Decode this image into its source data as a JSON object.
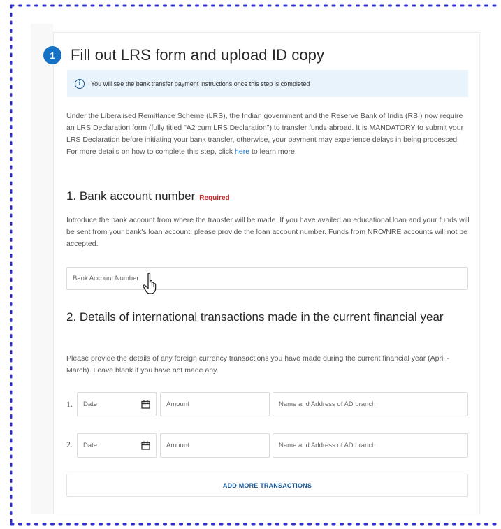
{
  "step": {
    "number": "1",
    "title": "Fill out LRS form and upload ID copy"
  },
  "info": {
    "icon": "info-icon",
    "text": "You will see the bank transfer payment instructions once this step is completed"
  },
  "intro": {
    "text_before_link": "Under the Liberalised Remittance Scheme (LRS), the Indian government and the Reserve Bank of India (RBI) now require an LRS Declaration form (fully titled \"A2 cum LRS Declaration\") to transfer funds abroad. It is MANDATORY to submit your LRS Declaration before initiating your bank transfer, otherwise, your payment may experience delays in being processed. For more details on how to complete this step, click ",
    "link_text": "here",
    "text_after_link": " to learn more."
  },
  "bank_section": {
    "title": "1. Bank account number",
    "required_label": "Required",
    "description": "Introduce the bank account from where the transfer will be made. If you have availed an educational loan and your funds will be sent from your bank's loan account, please provide the loan account number. Funds from NRO/NRE accounts will not be accepted.",
    "input_placeholder": "Bank Account Number"
  },
  "transactions_section": {
    "title": "2. Details of international transactions made in the current financial year",
    "description": "Please provide the details of any foreign currency transactions you have made during the current financial year (April - March). Leave blank if you have not made any.",
    "rows": [
      {
        "number": "1.",
        "date_placeholder": "Date",
        "amount_placeholder": "Amount",
        "branch_placeholder": "Name and Address of AD branch"
      },
      {
        "number": "2.",
        "date_placeholder": "Date",
        "amount_placeholder": "Amount",
        "branch_placeholder": "Name and Address of AD branch"
      }
    ],
    "add_button_label": "ADD MORE TRANSACTIONS"
  },
  "colors": {
    "accent": "#1670c4",
    "info_background": "#e8f3fc",
    "required": "#c62828",
    "frame_dots": "#2f2fd0"
  }
}
